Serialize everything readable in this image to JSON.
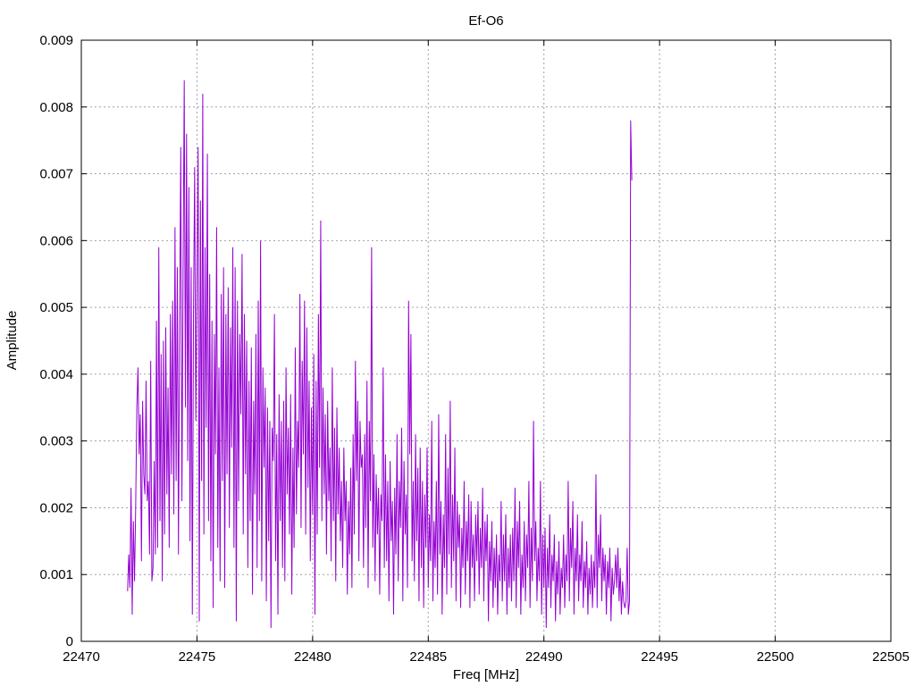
{
  "chart_data": {
    "type": "line",
    "title": "Ef-O6",
    "xlabel": "Freq [MHz]",
    "ylabel": "Amplitude",
    "xlim": [
      22470,
      22505
    ],
    "ylim": [
      0,
      0.009
    ],
    "x_ticks": [
      "22470",
      "22475",
      "22480",
      "22485",
      "22490",
      "22495",
      "22500",
      "22505"
    ],
    "y_ticks": [
      "0",
      "0.001",
      "0.002",
      "0.003",
      "0.004",
      "0.005",
      "0.006",
      "0.007",
      "0.008",
      "0.009"
    ],
    "grid": true,
    "series_color": "#9400d3",
    "series": [
      {
        "x_start": 22472.0,
        "x_step": 0.05,
        "values": [
          0.00075,
          0.0013,
          0.0008,
          0.0023,
          0.0004,
          0.0018,
          0.0009,
          0.002,
          0.0035,
          0.0041,
          0.0028,
          0.0034,
          0.0012,
          0.0036,
          0.0025,
          0.0022,
          0.0039,
          0.0021,
          0.0024,
          0.0013,
          0.0042,
          0.0009,
          0.0011,
          0.0027,
          0.0013,
          0.0048,
          0.0014,
          0.0059,
          0.0018,
          0.0043,
          0.0009,
          0.0045,
          0.0016,
          0.0047,
          0.0022,
          0.0038,
          0.0014,
          0.0049,
          0.0025,
          0.0051,
          0.0019,
          0.0062,
          0.0024,
          0.0056,
          0.0013,
          0.0048,
          0.0074,
          0.0021,
          0.0055,
          0.0084,
          0.0035,
          0.0076,
          0.0027,
          0.0068,
          0.0015,
          0.0056,
          0.0004,
          0.0049,
          0.0071,
          0.0033,
          0.0054,
          0.0074,
          0.0003,
          0.0066,
          0.0024,
          0.0082,
          0.0016,
          0.0059,
          0.0032,
          0.0073,
          0.0018,
          0.0055,
          0.0012,
          0.0048,
          0.0005,
          0.0046,
          0.0028,
          0.0062,
          0.0014,
          0.0041,
          0.0009,
          0.0052,
          0.0024,
          0.0056,
          0.0008,
          0.0049,
          0.0025,
          0.0053,
          0.0017,
          0.0047,
          0.0029,
          0.0059,
          0.0014,
          0.0056,
          0.0003,
          0.0051,
          0.0021,
          0.0046,
          0.0034,
          0.0058,
          0.0016,
          0.0049,
          0.0025,
          0.0045,
          0.0011,
          0.0039,
          0.0018,
          0.0044,
          0.0007,
          0.0036,
          0.0022,
          0.0046,
          0.0011,
          0.0051,
          0.0018,
          0.006,
          0.0009,
          0.0041,
          0.0026,
          0.0038,
          0.0006,
          0.0035,
          0.0015,
          0.0033,
          0.0002,
          0.0032,
          0.0027,
          0.0049,
          0.0012,
          0.0031,
          0.0004,
          0.0037,
          0.0018,
          0.0033,
          0.0011,
          0.0036,
          0.0009,
          0.0041,
          0.0022,
          0.0032,
          0.0016,
          0.0037,
          0.0007,
          0.0029,
          0.0014,
          0.0044,
          0.0019,
          0.0033,
          0.0026,
          0.0052,
          0.0017,
          0.0042,
          0.0028,
          0.0051,
          0.0016,
          0.0047,
          0.0023,
          0.0039,
          0.0012,
          0.0035,
          0.0019,
          0.0043,
          0.0004,
          0.0039,
          0.0016,
          0.0049,
          0.0026,
          0.0063,
          0.0018,
          0.0038,
          0.0022,
          0.0034,
          0.0013,
          0.0036,
          0.0021,
          0.0029,
          0.0012,
          0.0041,
          0.0018,
          0.0032,
          0.0009,
          0.0035,
          0.0019,
          0.0029,
          0.0015,
          0.0024,
          0.0011,
          0.0029,
          0.0018,
          0.0024,
          0.0007,
          0.0021,
          0.0013,
          0.0026,
          0.0008,
          0.0031,
          0.0016,
          0.0042,
          0.0024,
          0.0036,
          0.0012,
          0.0033,
          0.0026,
          0.0028,
          0.0011,
          0.0031,
          0.0017,
          0.0039,
          0.0008,
          0.0033,
          0.0021,
          0.0059,
          0.0014,
          0.0028,
          0.0009,
          0.0025,
          0.0016,
          0.0023,
          0.0007,
          0.0022,
          0.0018,
          0.0041,
          0.0011,
          0.0028,
          0.0012,
          0.0024,
          0.0006,
          0.0027,
          0.0015,
          0.0021,
          0.0004,
          0.0023,
          0.0013,
          0.0031,
          0.0009,
          0.0024,
          0.0017,
          0.0032,
          0.0006,
          0.0027,
          0.0016,
          0.0022,
          0.0008,
          0.0051,
          0.0028,
          0.0046,
          0.0012,
          0.0024,
          0.0009,
          0.0031,
          0.0015,
          0.0026,
          0.0006,
          0.0029,
          0.0011,
          0.0024,
          0.0005,
          0.0022,
          0.0014,
          0.0029,
          0.0008,
          0.0019,
          0.0012,
          0.0033,
          0.0006,
          0.0018,
          0.0011,
          0.0024,
          0.0007,
          0.0034,
          0.0013,
          0.0021,
          0.0004,
          0.0019,
          0.0011,
          0.0031,
          0.0007,
          0.0026,
          0.0013,
          0.0036,
          0.0008,
          0.0022,
          0.0012,
          0.0029,
          0.0006,
          0.0021,
          0.0014,
          0.0019,
          0.0005,
          0.0017,
          0.0011,
          0.0024,
          0.0007,
          0.0018,
          0.0012,
          0.0022,
          0.0005,
          0.0021,
          0.0011,
          0.0016,
          0.0006,
          0.0019,
          0.0012,
          0.0021,
          0.0007,
          0.0017,
          0.0011,
          0.0023,
          0.0006,
          0.0018,
          0.0012,
          0.0019,
          0.0003,
          0.0015,
          0.0009,
          0.0018,
          0.0005,
          0.0014,
          0.0008,
          0.0016,
          0.0004,
          0.0013,
          0.0009,
          0.0021,
          0.0006,
          0.0016,
          0.0009,
          0.0019,
          0.0004,
          0.0014,
          0.0008,
          0.0016,
          0.0006,
          0.0017,
          0.0009,
          0.0023,
          0.0005,
          0.0018,
          0.0011,
          0.0021,
          0.0004,
          0.0013,
          0.0008,
          0.0018,
          0.0006,
          0.0016,
          0.0011,
          0.0024,
          0.0005,
          0.0017,
          0.0009,
          0.0033,
          0.0012,
          0.0018,
          0.0006,
          0.0014,
          0.0009,
          0.0024,
          0.0004,
          0.0016,
          0.0008,
          0.0017,
          0.0002,
          0.0014,
          0.0008,
          0.0019,
          0.0005,
          0.0013,
          0.0009,
          0.0016,
          0.0003,
          0.0012,
          0.0007,
          0.0015,
          0.0004,
          0.0011,
          0.0008,
          0.0016,
          0.0005,
          0.0013,
          0.0009,
          0.0024,
          0.0006,
          0.0017,
          0.0011,
          0.0021,
          0.0004,
          0.0014,
          0.0009,
          0.0019,
          0.0006,
          0.0013,
          0.0009,
          0.0018,
          0.0005,
          0.0012,
          0.0008,
          0.0015,
          0.0004,
          0.0011,
          0.0007,
          0.0013,
          0.0005,
          0.0012,
          0.0008,
          0.0025,
          0.0005,
          0.0016,
          0.0011,
          0.0019,
          0.0006,
          0.0014,
          0.0009,
          0.0013,
          0.0004,
          0.0012,
          0.0008,
          0.0014,
          0.0003,
          0.0011,
          0.0007,
          0.0009,
          0.0013,
          0.0008,
          0.0014,
          0.0006,
          0.0011,
          0.0004,
          0.0009,
          0.0006,
          0.0005,
          0.0006,
          0.0014,
          0.0004,
          0.0006,
          0.0078,
          0.0069
        ]
      }
    ]
  }
}
